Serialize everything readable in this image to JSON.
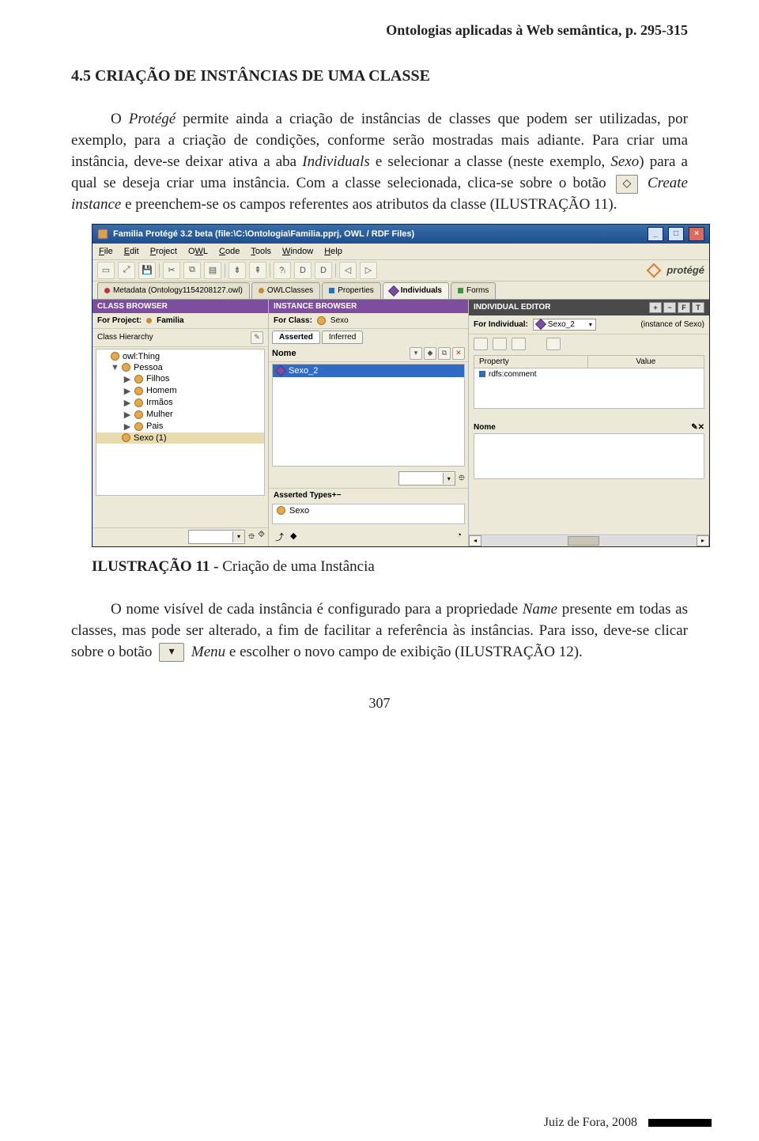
{
  "header": {
    "running": "Ontologias aplicadas à Web semântica, p. 295-315"
  },
  "section": {
    "title": "4.5 CRIAÇÃO DE INSTÂNCIAS DE UMA CLASSE"
  },
  "para1": {
    "seg1": "O ",
    "seg2": "Protégé",
    "seg3": " permite ainda a criação de instâncias de classes que podem ser utilizadas, por exemplo, para a criação de condições, conforme serão mostradas mais adiante. Para criar uma instância, deve-se deixar ativa a aba ",
    "seg4": "Individuals",
    "seg5": " e selecionar a classe (neste exemplo, ",
    "seg6": "Sexo",
    "seg7": ") para a qual se deseja criar uma instância. Com a classe selecionada, clica-se sobre o botão ",
    "seg8": "Create instance",
    "seg9": " e preenchem-se os campos referentes aos atributos da classe (ILUSTRAÇÃO 11)."
  },
  "button_glyph1": "◇",
  "figure_caption": {
    "bold": "ILUSTRAÇÃO 11 - ",
    "rest": "Criação de uma Instância"
  },
  "para2": {
    "seg1": "O nome visível de cada instância é configurado para a propriedade ",
    "seg2": "Name",
    "seg3": " presente em todas as classes, mas pode ser alterado, a fim de facilitar a referência às instâncias. Para isso, deve-se clicar sobre o botão ",
    "seg4": "Menu",
    "seg5": " e escolher o novo campo de exibição (ILUSTRAÇÃO 12)."
  },
  "button_glyph2": "▾",
  "page_number": "307",
  "footer_text": "Juiz de Fora, 2008",
  "app": {
    "title": "Familia  Protégé 3.2 beta    (file:\\C:\\Ontologia\\Familia.pprj, OWL / RDF Files)",
    "window_buttons": {
      "min": "_",
      "max": "□",
      "close": "×"
    },
    "menubar": [
      "File",
      "Edit",
      "Project",
      "OWL",
      "Code",
      "Tools",
      "Window",
      "Help"
    ],
    "brand": "protégé",
    "tabs": {
      "metadata": "Metadata (Ontology1154208127.owl)",
      "owlclasses": "OWLClasses",
      "properties": "Properties",
      "individuals": "Individuals",
      "forms": "Forms"
    },
    "class_browser": {
      "header": "CLASS BROWSER",
      "for_project_label": "For Project:",
      "for_project_value": "Familia",
      "hierarchy_label": "Class Hierarchy",
      "tree": {
        "root": "owl:Thing",
        "pessoa": "Pessoa",
        "children": [
          "Filhos",
          "Homem",
          "Irmãos",
          "Mulher",
          "Pais"
        ],
        "sexo": "Sexo (1)"
      }
    },
    "instance_browser": {
      "header": "INSTANCE BROWSER",
      "for_class_label": "For Class:",
      "for_class_value": "Sexo",
      "tab_asserted": "Asserted",
      "tab_inferred": "Inferred",
      "nome_label": "Nome",
      "item": "Sexo_2",
      "types_label": "Asserted Types",
      "types_value": "Sexo"
    },
    "individual_editor": {
      "header": "INDIVIDUAL EDITOR",
      "for_ind_label": "For Individual:",
      "for_ind_value": "Sexo_2",
      "instance_of": "(instance of Sexo)",
      "col_property": "Property",
      "col_value": "Value",
      "row_prop": "rdfs:comment",
      "nome_label": "Nome",
      "hdr_buttons": {
        "plus": "+",
        "minus": "−",
        "f": "F",
        "t": "T"
      }
    }
  }
}
